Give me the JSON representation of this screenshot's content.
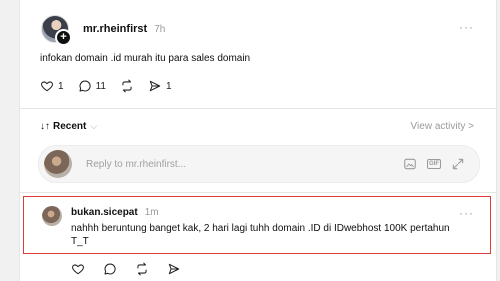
{
  "post": {
    "username": "mr.rheinfirst",
    "time": "7h",
    "text": "infokan domain .id murah itu para sales domain",
    "likes": "1",
    "replies": "11",
    "shares": "1",
    "more": "···"
  },
  "sort": {
    "label": "Recent",
    "arrows": "↓↑",
    "view_activity": "View activity >"
  },
  "reply_box": {
    "placeholder": "Reply to mr.rheinfirst...",
    "gif_label": "GIF"
  },
  "comment": {
    "username": "bukan.sicepat",
    "time": "1m",
    "text": "nahhh beruntung banget kak, 2 hari lagi tuhh domain .ID di IDwebhost 100K pertahun T_T",
    "more": "···"
  },
  "colors": {
    "highlight": "#e03a3a",
    "muted": "#9a9a9a"
  }
}
